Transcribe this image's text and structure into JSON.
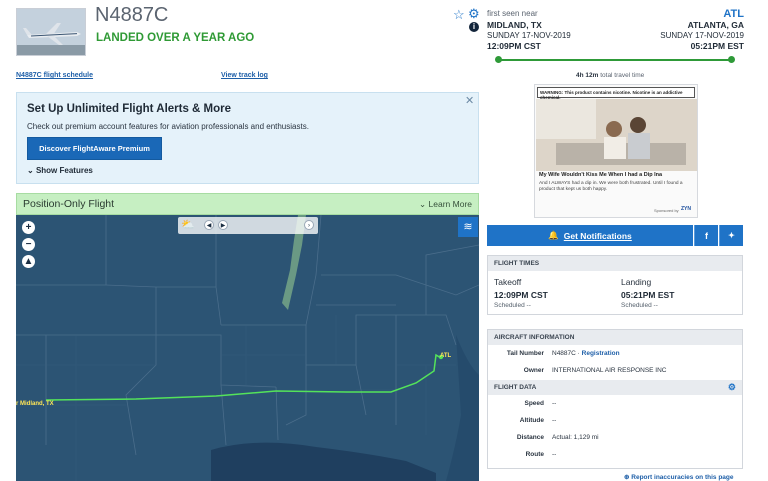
{
  "flight": {
    "ident": "N4887C",
    "status": "LANDED OVER A YEAR AGO",
    "schedule_link": "N4887C flight schedule",
    "track_link": "View track log"
  },
  "route": {
    "origin_caption": "first seen near",
    "origin_city": "MIDLAND, TX",
    "origin_date": "SUNDAY 17-NOV-2019",
    "origin_time": "12:09PM CST",
    "dest_code": "ATL",
    "dest_city": "ATLANTA, GA",
    "dest_date": "SUNDAY 17-NOV-2019",
    "dest_time": "05:21PM EST",
    "travel_time": "4h 12m",
    "travel_time_suffix": "total travel time"
  },
  "promo": {
    "title": "Set Up Unlimited Flight Alerts & More",
    "text": "Check out premium account features for aviation professionals and enthusiasts.",
    "button": "Discover FlightAware Premium",
    "show": "Show Features",
    "close": "✕"
  },
  "map": {
    "header": "Position-Only Flight",
    "learn_more": "Learn More",
    "origin_label": "r Midland, TX",
    "dest_label": "ATL"
  },
  "ad": {
    "warning": "WARNING: This product contains nicotine. Nicotine is an addictive chemical.",
    "headline": "My Wife Wouldn't Kiss Me When I had a Dip Ina",
    "body": "And I ALWAYS had a dip in. We were both frustrated. Until I found a product that kept us both happy.",
    "sponsored": "Sponsored by",
    "brand": "ZYN"
  },
  "notifications": {
    "label": "Get Notifications",
    "facebook": "f",
    "twitter": "🐦"
  },
  "flight_times": {
    "header": "FLIGHT TIMES",
    "takeoff_label": "Takeoff",
    "takeoff_time": "12:09PM CST",
    "takeoff_sched": "Scheduled --",
    "landing_label": "Landing",
    "landing_time": "05:21PM EST",
    "landing_sched": "Scheduled --"
  },
  "aircraft": {
    "header": "AIRCRAFT INFORMATION",
    "tail_key": "Tail Number",
    "tail_val": "N4887C",
    "registration_link": "Registration",
    "owner_key": "Owner",
    "owner_val": "INTERNATIONAL AIR RESPONSE INC"
  },
  "flight_data": {
    "header": "FLIGHT DATA",
    "speed_key": "Speed",
    "speed_val": "--",
    "altitude_key": "Altitude",
    "altitude_val": "--",
    "distance_key": "Distance",
    "distance_val": "Actual: 1,129 mi",
    "route_key": "Route",
    "route_val": "--"
  },
  "report_link": "Report inaccuracies on this page",
  "colors": {
    "accent": "#1f73c7",
    "landed_green": "#2f9a35",
    "track_green": "#54e35a",
    "map_water": "#2a4f6e"
  }
}
